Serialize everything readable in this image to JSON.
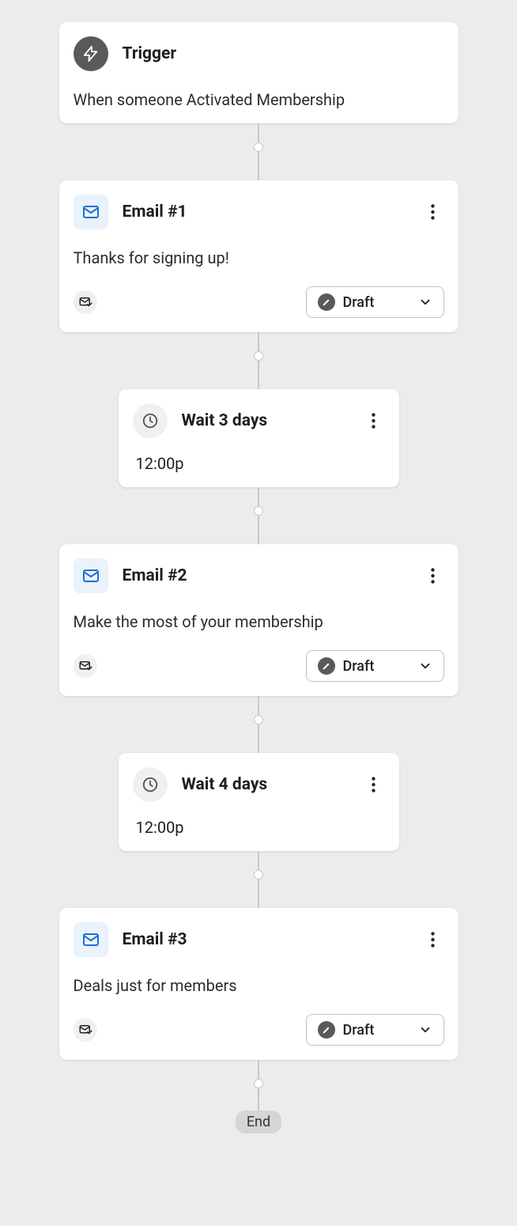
{
  "trigger": {
    "title": "Trigger",
    "description": "When someone Activated Membership"
  },
  "steps": [
    {
      "type": "email",
      "title": "Email #1",
      "description": "Thanks for signing up!",
      "status": "Draft"
    },
    {
      "type": "wait",
      "title": "Wait 3 days",
      "time": "12:00p"
    },
    {
      "type": "email",
      "title": "Email #2",
      "description": "Make the most of your membership",
      "status": "Draft"
    },
    {
      "type": "wait",
      "title": "Wait 4 days",
      "time": "12:00p"
    },
    {
      "type": "email",
      "title": "Email #3",
      "description": "Deals just for members",
      "status": "Draft"
    }
  ],
  "end_label": "End"
}
